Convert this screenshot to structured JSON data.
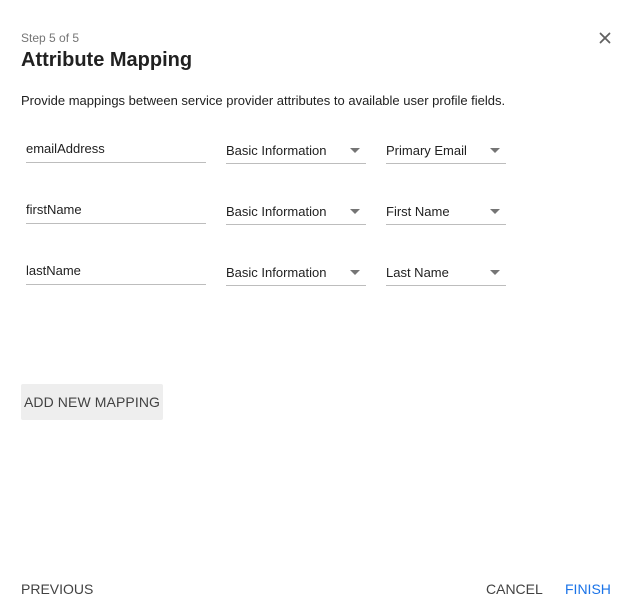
{
  "dialog": {
    "step": "Step 5 of 5",
    "title": "Attribute Mapping",
    "description": "Provide mappings between service provider attributes to available user profile fields.",
    "close_icon": "close-icon"
  },
  "mappings": [
    {
      "attribute": "emailAddress",
      "category": "Basic Information",
      "field": "Primary Email"
    },
    {
      "attribute": "firstName",
      "category": "Basic Information",
      "field": "First Name"
    },
    {
      "attribute": "lastName",
      "category": "Basic Information",
      "field": "Last Name"
    }
  ],
  "actions": {
    "add_mapping": "ADD NEW MAPPING",
    "previous": "PREVIOUS",
    "cancel": "CANCEL",
    "finish": "FINISH"
  },
  "colors": {
    "accent": "#1a73e8",
    "text": "#212121",
    "muted": "#757575",
    "button_bg": "#eeeeee"
  }
}
